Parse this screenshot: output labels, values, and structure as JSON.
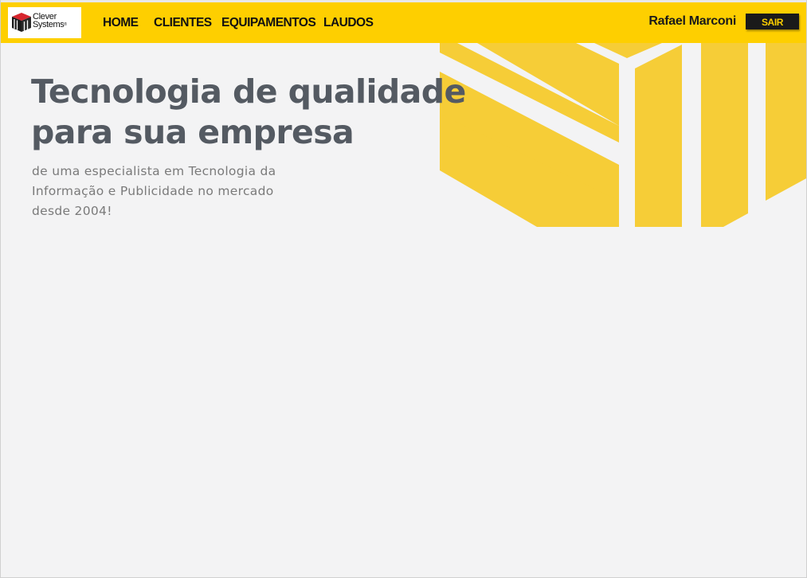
{
  "header": {
    "logo": {
      "line1": "Clever",
      "line2": "Systems",
      "mark": "®"
    },
    "nav": [
      {
        "label": "HOME"
      },
      {
        "label": "CLIENTES"
      },
      {
        "label": "EQUIPAMENTOS"
      },
      {
        "label": "LAUDOS"
      }
    ],
    "user_name": "Rafael Marconi",
    "logout_label": "SAIR"
  },
  "hero": {
    "headline_line1": "Tecnologia de qualidade",
    "headline_line2": "para sua empresa",
    "sub_line1": "de uma especialista em Tecnologia da",
    "sub_line2": "Informação e Publicidade no mercado",
    "sub_line3": "desde 2004!"
  },
  "colors": {
    "brand_yellow": "#fecf00",
    "graphic_yellow": "#f6cd37",
    "background": "#f3f3f4",
    "headline_gray": "#545a62",
    "dark": "#1a1a1a"
  }
}
